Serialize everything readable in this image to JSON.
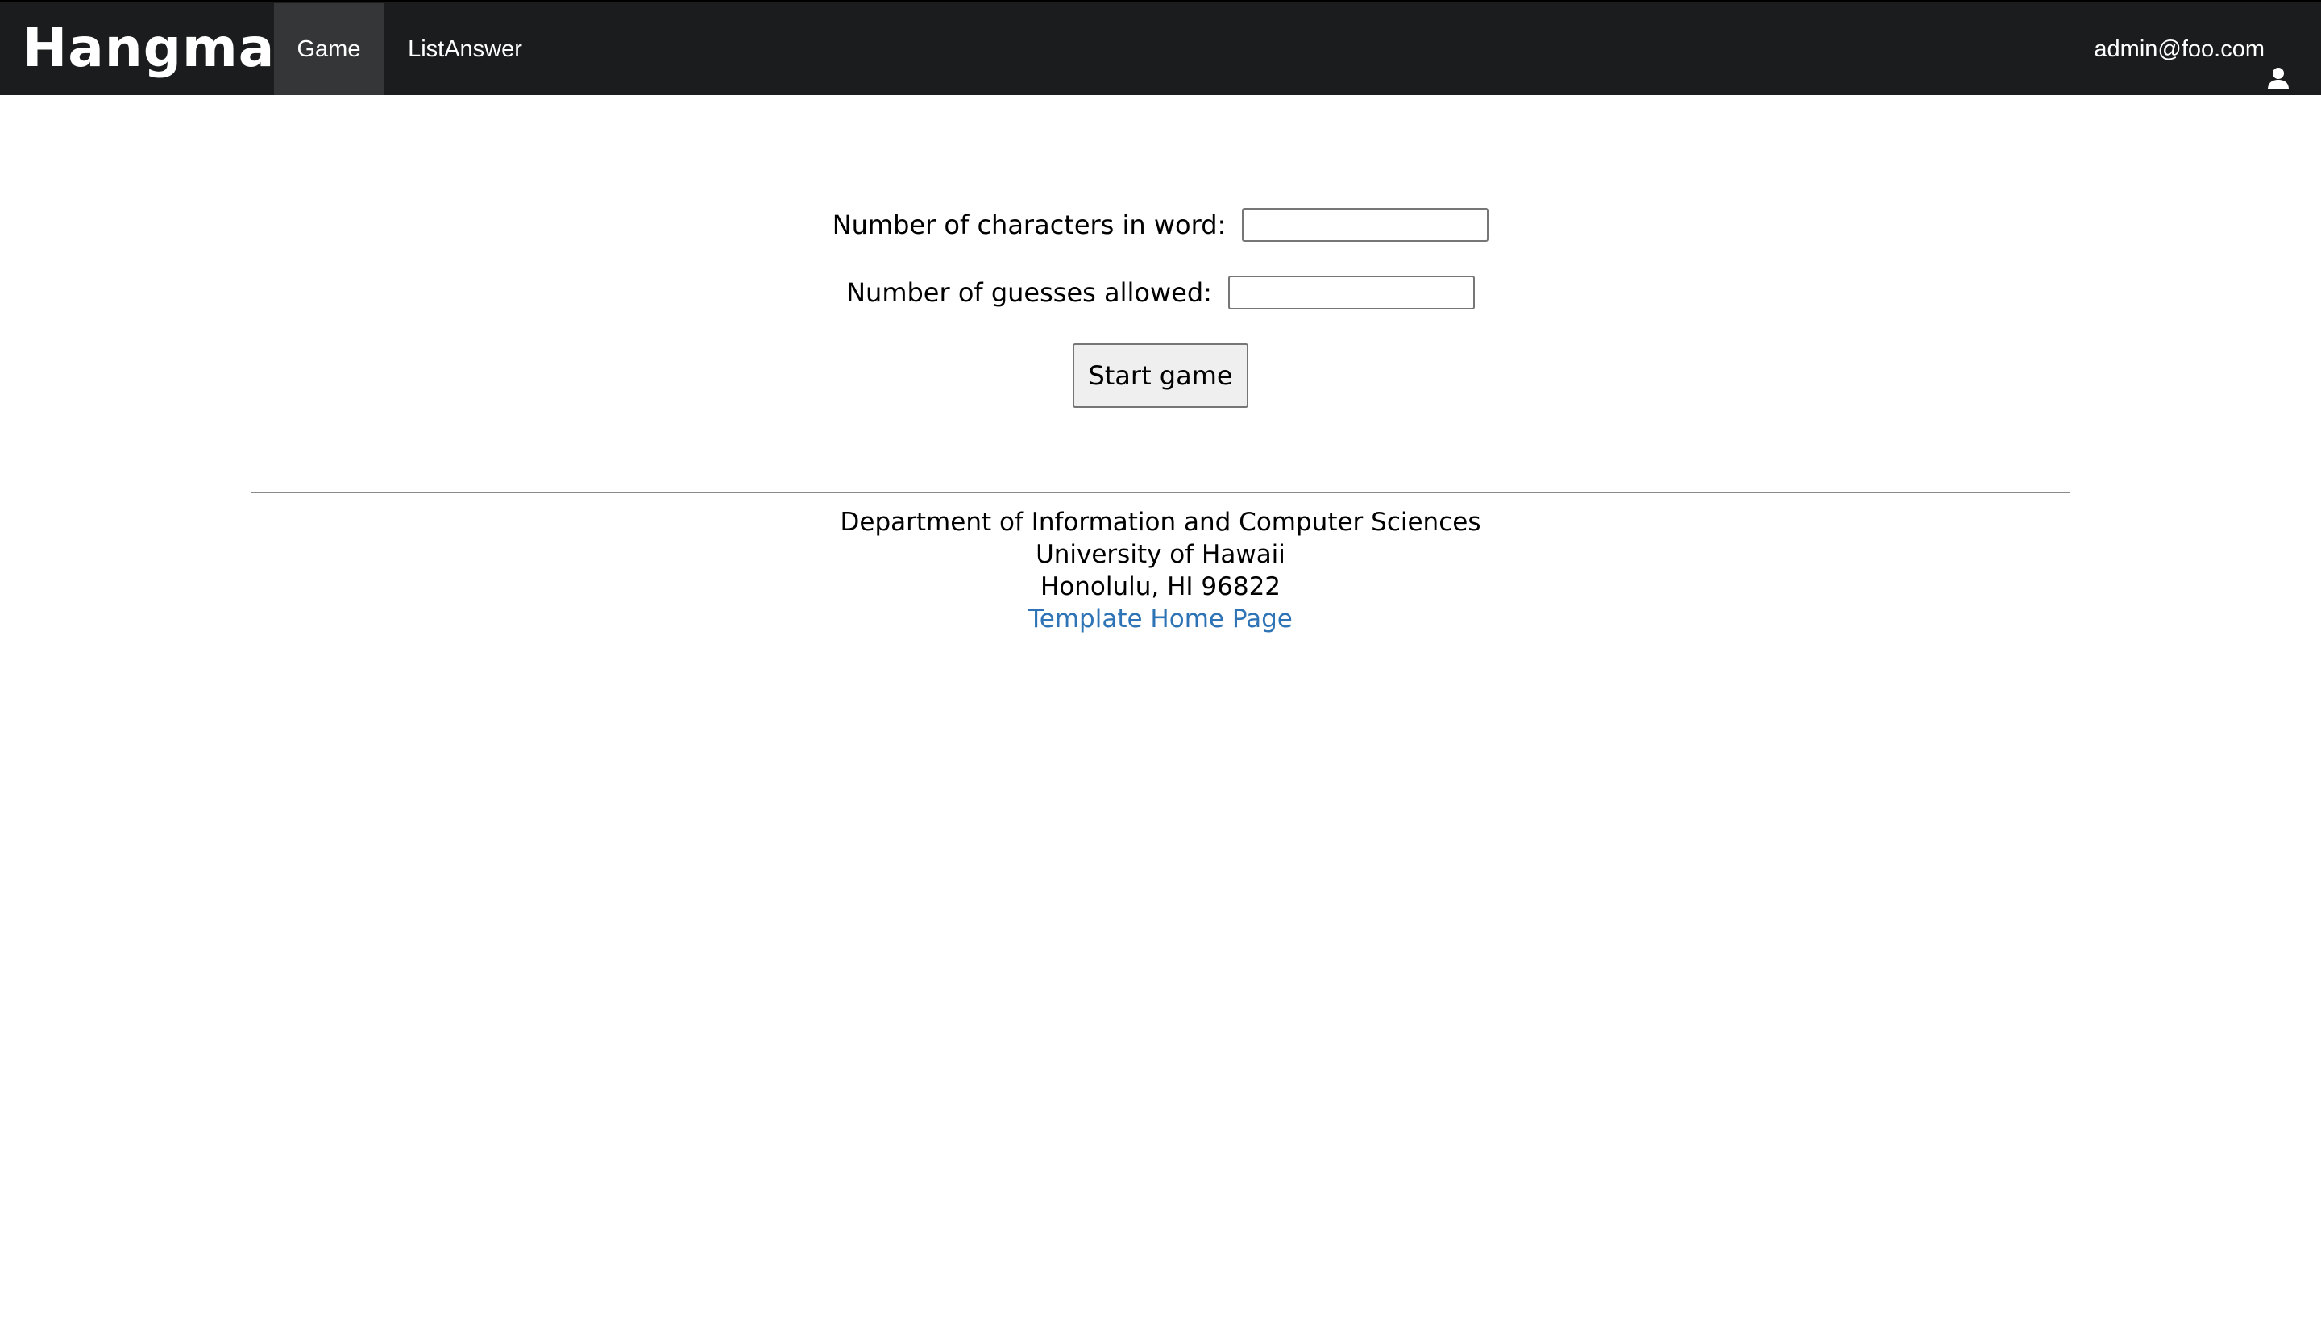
{
  "navbar": {
    "brand": "Hangman",
    "items": [
      {
        "label": "Game",
        "active": true
      },
      {
        "label": "ListAnswer",
        "active": false
      }
    ],
    "user": {
      "email": "admin@foo.com",
      "icon": "user-icon"
    },
    "colors": {
      "background": "#1b1c1d",
      "active_item": "#353637",
      "text": "#ffffff"
    }
  },
  "form": {
    "chars_label": "Number of characters in word:",
    "chars_value": "",
    "guesses_label": "Number of guesses allowed:",
    "guesses_value": "",
    "submit_label": "Start game"
  },
  "footer": {
    "line1": "Department of Information and Computer Sciences",
    "line2": "University of Hawaii",
    "line3": "Honolulu, HI 96822",
    "link": "Template Home Page",
    "link_color": "#2d73b5"
  }
}
